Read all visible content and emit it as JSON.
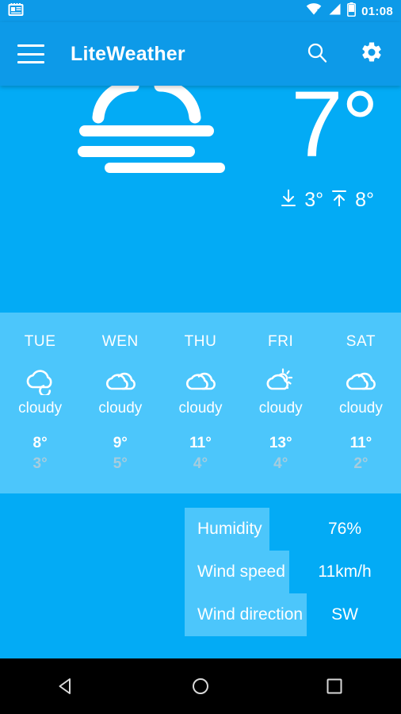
{
  "status_bar": {
    "time": "01:08",
    "icons": [
      "news-notification-icon",
      "wifi-no-internet-icon",
      "cellular-signal-icon",
      "battery-icon"
    ]
  },
  "app_bar": {
    "menu_icon": "hamburger-menu-icon",
    "title": "LiteWeather",
    "search_icon": "search-icon",
    "settings_icon": "gear-icon"
  },
  "current": {
    "condition_icon": "fog-icon",
    "temperature": "7°",
    "low_icon": "arrow-down-to-line-icon",
    "low": "3°",
    "high_icon": "arrow-up-to-line-icon",
    "high": "8°"
  },
  "forecast": [
    {
      "dow": "TUE",
      "icon": "cloudy-icon",
      "condition": "cloudy",
      "high": "8°",
      "low": "3°"
    },
    {
      "dow": "WEN",
      "icon": "cloudy-icon",
      "condition": "cloudy",
      "high": "9°",
      "low": "5°"
    },
    {
      "dow": "THU",
      "icon": "cloudy-icon",
      "condition": "cloudy",
      "high": "11°",
      "low": "4°"
    },
    {
      "dow": "FRI",
      "icon": "partly-cloudy-icon",
      "condition": "cloudy",
      "high": "13°",
      "low": "4°"
    },
    {
      "dow": "SAT",
      "icon": "cloudy-icon",
      "condition": "cloudy",
      "high": "11°",
      "low": "2°"
    }
  ],
  "details": {
    "icon": "fog-icon",
    "rows": [
      {
        "label": "Humidity",
        "value": "76%",
        "highlight_width": 107
      },
      {
        "label": "Wind speed",
        "value": "11km/h",
        "highlight_width": 132
      },
      {
        "label": "Wind direction",
        "value": "SW",
        "highlight_width": 154
      }
    ]
  },
  "nav_bar": {
    "back": "back-triangle-icon",
    "home": "home-circle-icon",
    "recents": "recents-square-icon"
  },
  "colors": {
    "app_bar": "#0D9AE8",
    "hero": "#03ABF5",
    "forecast": "#4CC6FB",
    "details": "#03ABF5",
    "highlight": "#4CC6FB",
    "low_temp": "#A6CCDD",
    "nav_bar": "#000000"
  }
}
